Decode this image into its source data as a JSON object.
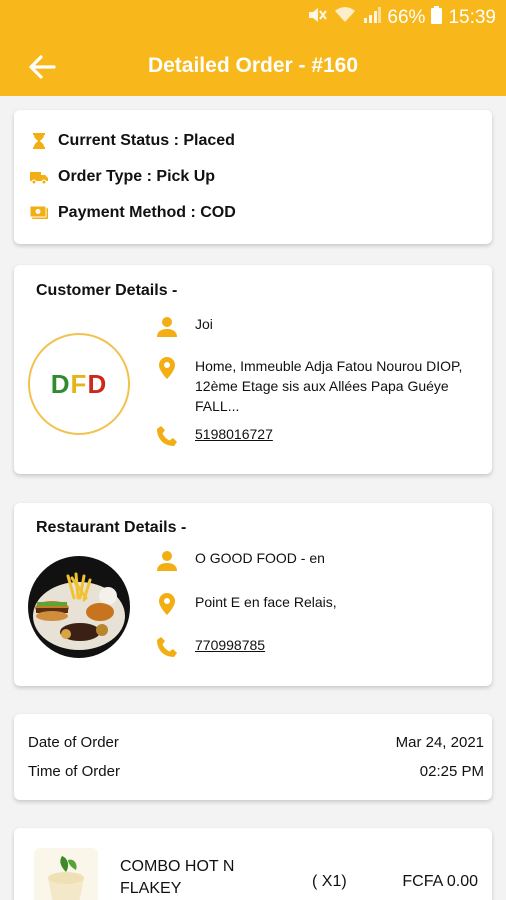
{
  "status_bar": {
    "battery": "66%",
    "time": "15:39"
  },
  "app_bar": {
    "title": "Detailed Order - #160"
  },
  "order_status": {
    "current_status": "Current Status : Placed",
    "order_type": "Order Type : Pick Up",
    "payment_method": "Payment Method : COD"
  },
  "customer": {
    "heading": "Customer Details -",
    "logo_letters": [
      "D",
      "F",
      "D"
    ],
    "name": "Joi",
    "address": "Home, Immeuble Adja Fatou Nourou DIOP, 12ème Etage sis aux Allées Papa Guéye FALL...",
    "phone": "5198016727"
  },
  "restaurant": {
    "heading": "Restaurant Details -",
    "name": "O GOOD FOOD - en",
    "address": "Point E en face Relais,",
    "phone": "770998785"
  },
  "order_info": {
    "date_label": "Date of Order",
    "date_value": "Mar 24, 2021",
    "time_label": "Time of Order",
    "time_value": "02:25 PM"
  },
  "items": [
    {
      "name": "COMBO HOT N FLAKEY",
      "qty": "( X1)",
      "price": "FCFA 0.00"
    }
  ],
  "colors": {
    "accent": "#f8b71a",
    "icon": "#f2ae13"
  }
}
